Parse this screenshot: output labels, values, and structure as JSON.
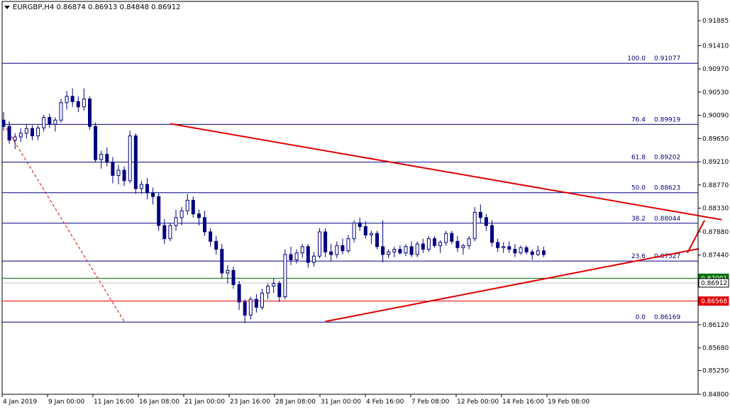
{
  "header": {
    "symbol": "EURGBP,H4",
    "open": "0.86874",
    "high": "0.86913",
    "low": "0.84848",
    "close": "0.86912"
  },
  "colors": {
    "background": "#ffffff",
    "candle": "#000080",
    "fib_level": "#000080",
    "trendline": "#e00000",
    "support_line": "#e00000",
    "resistance_green": "#007000",
    "bid_line": "#c0c0c0",
    "axis": "#000000"
  },
  "chart_data": {
    "type": "candlestick",
    "price_scale": [
      0.91885,
      0.9141,
      0.9097,
      0.9053,
      0.9009,
      0.8965,
      0.8921,
      0.8877,
      0.8833,
      0.8788,
      0.8744,
      0.87,
      0.8656,
      0.8612,
      0.8568,
      0.8525,
      0.848
    ],
    "price_labels": [
      "0.91885",
      "0.91410",
      "0.90970",
      "0.90530",
      "0.90090",
      "0.89650",
      "0.89210",
      "0.88770",
      "0.88330",
      "0.87880",
      "0.87440",
      "0.87001",
      "0.86568",
      "0.86120",
      "0.85680",
      "0.85250",
      "0.84800"
    ],
    "time_labels": [
      "4 Jan 2019",
      "9 Jan 00:00",
      "11 Jan 16:00",
      "16 Jan 08:00",
      "21 Jan 00:00",
      "23 Jan 16:00",
      "28 Jan 08:00",
      "31 Jan 00:00",
      "4 Feb 16:00",
      "7 Feb 08:00",
      "12 Feb 00:00",
      "14 Feb 16:00",
      "19 Feb 08:00"
    ],
    "ylim": [
      0.848,
      0.9225
    ],
    "fib_levels": [
      {
        "ratio": "100.0",
        "value": 0.91077,
        "text": "0.91077"
      },
      {
        "ratio": "76.4",
        "value": 0.89919,
        "text": "0.89919"
      },
      {
        "ratio": "61.8",
        "value": 0.89202,
        "text": "0.89202"
      },
      {
        "ratio": "50.0",
        "value": 0.88623,
        "text": "0.88623"
      },
      {
        "ratio": "38.2",
        "value": 0.88044,
        "text": "0.88044"
      },
      {
        "ratio": "23.6",
        "value": 0.87327,
        "text": "0.87327"
      },
      {
        "ratio": "0.0",
        "value": 0.86169,
        "text": "0.86169"
      }
    ],
    "horizontal_lines": [
      {
        "value": 0.87001,
        "text": "0.87001",
        "color": "#007000"
      },
      {
        "value": 0.86912,
        "text": "0.86912",
        "color": "#000000"
      },
      {
        "value": 0.86568,
        "text": "0.86568",
        "color": "#e00000"
      }
    ],
    "trendlines": [
      {
        "from_index": 29,
        "from_value": 0.8993,
        "to_index": 125,
        "to_value": 0.8811,
        "style": "solid"
      },
      {
        "from_index": 56,
        "from_value": 0.8618,
        "to_index": 121,
        "to_value": 0.8756,
        "style": "solid"
      },
      {
        "from_index": 119,
        "from_value": 0.8748,
        "to_index": 122,
        "to_value": 0.881,
        "style": "solid"
      },
      {
        "from_index": 0,
        "from_value": 0.8993,
        "to_index": 21,
        "to_value": 0.8618,
        "style": "dashed"
      }
    ],
    "candles": [
      [
        0.9,
        0.9015,
        0.898,
        0.8988
      ],
      [
        0.8988,
        0.8998,
        0.8955,
        0.8962
      ],
      [
        0.8962,
        0.8975,
        0.8945,
        0.8968
      ],
      [
        0.8968,
        0.8985,
        0.8958,
        0.8975
      ],
      [
        0.8975,
        0.8992,
        0.8965,
        0.8984
      ],
      [
        0.8984,
        0.899,
        0.8962,
        0.897
      ],
      [
        0.897,
        0.899,
        0.8962,
        0.8985
      ],
      [
        0.8985,
        0.901,
        0.8978,
        0.9005
      ],
      [
        0.9005,
        0.9012,
        0.8985,
        0.8992
      ],
      [
        0.8992,
        0.9005,
        0.8978,
        0.9
      ],
      [
        0.9,
        0.904,
        0.8995,
        0.9033
      ],
      [
        0.9033,
        0.9055,
        0.902,
        0.9045
      ],
      [
        0.9045,
        0.906,
        0.9025,
        0.9035
      ],
      [
        0.9035,
        0.9045,
        0.9015,
        0.9025
      ],
      [
        0.9025,
        0.906,
        0.9018,
        0.904
      ],
      [
        0.904,
        0.9045,
        0.8982,
        0.8988
      ],
      [
        0.8988,
        0.8995,
        0.892,
        0.8925
      ],
      [
        0.8925,
        0.8942,
        0.8908,
        0.8935
      ],
      [
        0.8935,
        0.8948,
        0.8912,
        0.892
      ],
      [
        0.892,
        0.893,
        0.888,
        0.8895
      ],
      [
        0.8895,
        0.8915,
        0.8878,
        0.8905
      ],
      [
        0.8905,
        0.8912,
        0.8875,
        0.8885
      ],
      [
        0.8885,
        0.898,
        0.888,
        0.897
      ],
      [
        0.897,
        0.8975,
        0.886,
        0.887
      ],
      [
        0.887,
        0.8885,
        0.886,
        0.8878
      ],
      [
        0.8878,
        0.889,
        0.885,
        0.8862
      ],
      [
        0.8862,
        0.8872,
        0.884,
        0.8855
      ],
      [
        0.8855,
        0.8862,
        0.879,
        0.88
      ],
      [
        0.88,
        0.8812,
        0.8765,
        0.8775
      ],
      [
        0.8775,
        0.8805,
        0.877,
        0.88
      ],
      [
        0.88,
        0.883,
        0.879,
        0.8815
      ],
      [
        0.8815,
        0.8835,
        0.88,
        0.8828
      ],
      [
        0.8828,
        0.886,
        0.882,
        0.8848
      ],
      [
        0.8848,
        0.8855,
        0.8815,
        0.8822
      ],
      [
        0.8822,
        0.883,
        0.88,
        0.8815
      ],
      [
        0.8815,
        0.8828,
        0.878,
        0.8788
      ],
      [
        0.8788,
        0.8795,
        0.876,
        0.877
      ],
      [
        0.877,
        0.878,
        0.8745,
        0.8755
      ],
      [
        0.8755,
        0.8765,
        0.87,
        0.871
      ],
      [
        0.871,
        0.8725,
        0.869,
        0.8715
      ],
      [
        0.8715,
        0.8722,
        0.868,
        0.8688
      ],
      [
        0.8688,
        0.8695,
        0.864,
        0.8655
      ],
      [
        0.8655,
        0.866,
        0.8615,
        0.863
      ],
      [
        0.863,
        0.8665,
        0.8622,
        0.866
      ],
      [
        0.866,
        0.867,
        0.8635,
        0.8645
      ],
      [
        0.8645,
        0.868,
        0.864,
        0.8672
      ],
      [
        0.8672,
        0.869,
        0.866,
        0.8685
      ],
      [
        0.8685,
        0.87,
        0.8672,
        0.869
      ],
      [
        0.869,
        0.8695,
        0.8655,
        0.8665
      ],
      [
        0.8665,
        0.8755,
        0.866,
        0.8745
      ],
      [
        0.8745,
        0.876,
        0.8725,
        0.8735
      ],
      [
        0.8735,
        0.8755,
        0.8728,
        0.8748
      ],
      [
        0.8748,
        0.8765,
        0.8738,
        0.876
      ],
      [
        0.876,
        0.8765,
        0.872,
        0.873
      ],
      [
        0.873,
        0.875,
        0.8722,
        0.8742
      ],
      [
        0.8742,
        0.8795,
        0.8738,
        0.8788
      ],
      [
        0.8788,
        0.8795,
        0.874,
        0.875
      ],
      [
        0.875,
        0.8765,
        0.8732,
        0.8745
      ],
      [
        0.8745,
        0.877,
        0.8738,
        0.8762
      ],
      [
        0.8762,
        0.8775,
        0.8745,
        0.8752
      ],
      [
        0.8752,
        0.8782,
        0.8748,
        0.8775
      ],
      [
        0.8775,
        0.881,
        0.8768,
        0.8805
      ],
      [
        0.8805,
        0.8815,
        0.879,
        0.8798
      ],
      [
        0.8798,
        0.8808,
        0.8775,
        0.8782
      ],
      [
        0.8782,
        0.879,
        0.8765,
        0.8785
      ],
      [
        0.8785,
        0.879,
        0.8755,
        0.876
      ],
      [
        0.876,
        0.881,
        0.873,
        0.8745
      ],
      [
        0.8745,
        0.8755,
        0.8738,
        0.875
      ],
      [
        0.875,
        0.876,
        0.874,
        0.8755
      ],
      [
        0.8755,
        0.8762,
        0.8745,
        0.8748
      ],
      [
        0.8748,
        0.8765,
        0.8742,
        0.876
      ],
      [
        0.876,
        0.877,
        0.874,
        0.8745
      ],
      [
        0.8745,
        0.877,
        0.874,
        0.8765
      ],
      [
        0.8765,
        0.8775,
        0.8748,
        0.8755
      ],
      [
        0.8755,
        0.878,
        0.875,
        0.8775
      ],
      [
        0.8775,
        0.878,
        0.8758,
        0.8762
      ],
      [
        0.8762,
        0.8772,
        0.8748,
        0.8768
      ],
      [
        0.8768,
        0.879,
        0.8762,
        0.8785
      ],
      [
        0.8785,
        0.879,
        0.8765,
        0.877
      ],
      [
        0.877,
        0.878,
        0.875,
        0.8758
      ],
      [
        0.8758,
        0.8765,
        0.8745,
        0.8762
      ],
      [
        0.8762,
        0.878,
        0.8755,
        0.8775
      ],
      [
        0.8775,
        0.8835,
        0.877,
        0.8825
      ],
      [
        0.8825,
        0.884,
        0.8805,
        0.8815
      ],
      [
        0.8815,
        0.8822,
        0.879,
        0.88
      ],
      [
        0.88,
        0.881,
        0.876,
        0.8768
      ],
      [
        0.8768,
        0.8775,
        0.875,
        0.8758
      ],
      [
        0.8758,
        0.8768,
        0.8748,
        0.876
      ],
      [
        0.876,
        0.877,
        0.8748,
        0.8755
      ],
      [
        0.8755,
        0.8765,
        0.874,
        0.8748
      ],
      [
        0.8748,
        0.8762,
        0.8745,
        0.8758
      ],
      [
        0.8758,
        0.8762,
        0.8745,
        0.875
      ],
      [
        0.875,
        0.8755,
        0.8735,
        0.8745
      ],
      [
        0.8745,
        0.8762,
        0.8742,
        0.8752
      ],
      [
        0.8752,
        0.876,
        0.874,
        0.8745
      ]
    ]
  }
}
